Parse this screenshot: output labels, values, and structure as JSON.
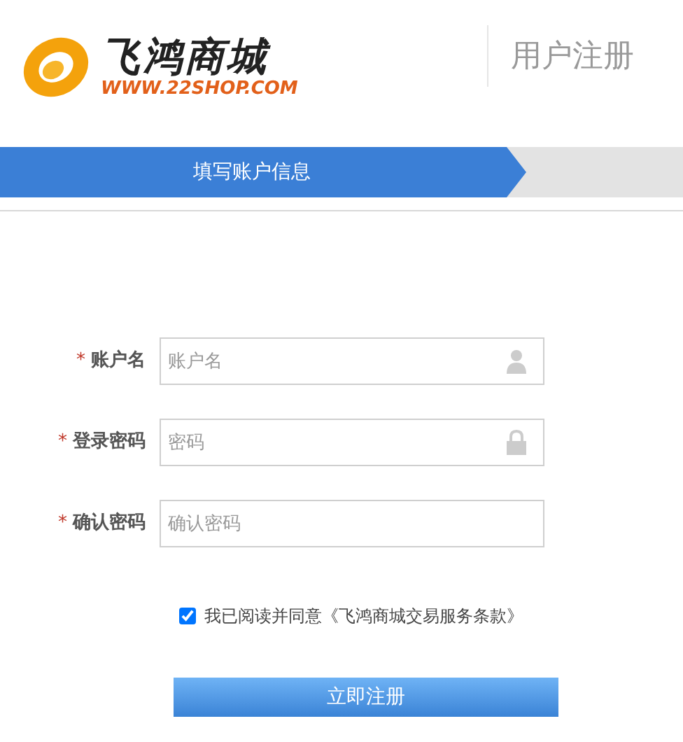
{
  "header": {
    "brand": "飞鸿商城",
    "site": "WWW.22SHOP.COM",
    "title": "用户注册"
  },
  "steps": [
    {
      "label": "填写账户信息",
      "selected": true
    }
  ],
  "fields": [
    {
      "kind": "user",
      "mark": "*",
      "label": "账户名",
      "placeholder": "账户名"
    },
    {
      "kind": "lock",
      "mark": "*",
      "label": "登录密码",
      "placeholder": "密码"
    },
    {
      "kind": "plain",
      "mark": "*",
      "label": "确认密码",
      "placeholder": "确认密码"
    }
  ],
  "agreement": {
    "checked": true,
    "text": "我已阅读并同意《飞鸿商城交易服务条款》"
  },
  "submit": "立即注册"
}
